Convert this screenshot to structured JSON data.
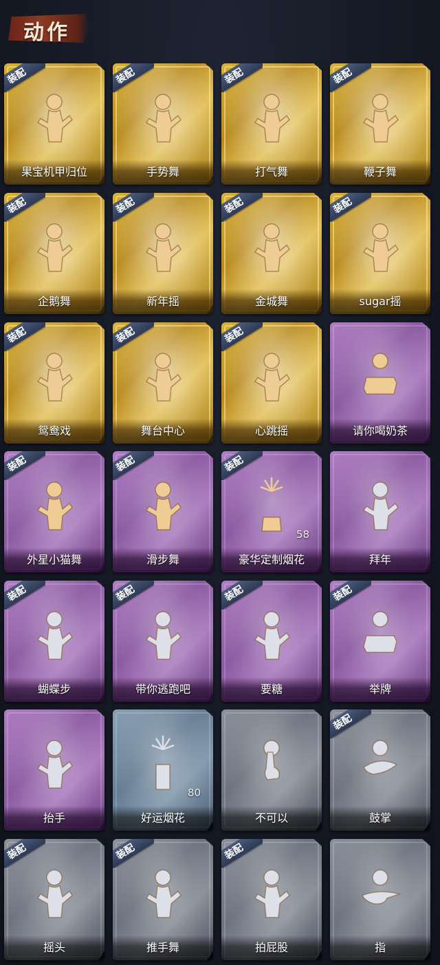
{
  "header": {
    "title": "动作"
  },
  "equip_label": "装配",
  "cards": [
    {
      "label": "果宝机甲归位",
      "tier": "gold",
      "equipped": true,
      "icon": "dance-figure-icon"
    },
    {
      "label": "手势舞",
      "tier": "gold",
      "equipped": true,
      "icon": "dance-figure-icon"
    },
    {
      "label": "打气舞",
      "tier": "gold",
      "equipped": true,
      "icon": "dance-figure-icon"
    },
    {
      "label": "鞭子舞",
      "tier": "gold",
      "equipped": true,
      "icon": "dance-figure-icon"
    },
    {
      "label": "企鹅舞",
      "tier": "gold",
      "equipped": true,
      "icon": "dance-figure-icon"
    },
    {
      "label": "新年摇",
      "tier": "gold",
      "equipped": true,
      "icon": "dance-figure-icon"
    },
    {
      "label": "金城舞",
      "tier": "gold",
      "equipped": true,
      "icon": "dance-figure-icon"
    },
    {
      "label": "sugar摇",
      "tier": "gold",
      "equipped": true,
      "icon": "dance-figure-icon"
    },
    {
      "label": "鸳鸯戏",
      "tier": "gold",
      "equipped": true,
      "icon": "dance-figure-icon"
    },
    {
      "label": "舞台中心",
      "tier": "gold",
      "equipped": true,
      "icon": "dance-figure-icon"
    },
    {
      "label": "心跳摇",
      "tier": "gold",
      "equipped": true,
      "icon": "dance-figure-icon"
    },
    {
      "label": "请你喝奶茶",
      "tier": "purple",
      "equipped": false,
      "icon": "sign-figure-icon"
    },
    {
      "label": "外星小猫舞",
      "tier": "purple",
      "equipped": true,
      "icon": "dance-figure-icon"
    },
    {
      "label": "滑步舞",
      "tier": "purple",
      "equipped": true,
      "icon": "dance-figure-icon"
    },
    {
      "label": "豪华定制烟花",
      "tier": "purple",
      "equipped": true,
      "icon": "fireworks-box-icon",
      "count": "58"
    },
    {
      "label": "拜年",
      "tier": "purple",
      "equipped": false,
      "icon": "bow-figure-icon"
    },
    {
      "label": "蝴蝶步",
      "tier": "purple",
      "equipped": true,
      "icon": "dance-figure-icon"
    },
    {
      "label": "带你逃跑吧",
      "tier": "purple",
      "equipped": true,
      "icon": "dance-figure-icon"
    },
    {
      "label": "要糖",
      "tier": "purple",
      "equipped": true,
      "icon": "reach-figure-icon"
    },
    {
      "label": "举牌",
      "tier": "purple",
      "equipped": true,
      "icon": "sign-figure-icon"
    },
    {
      "label": "抬手",
      "tier": "purple",
      "equipped": false,
      "icon": "raise-hand-figure-icon"
    },
    {
      "label": "好运烟花",
      "tier": "blue",
      "equipped": false,
      "icon": "firework-can-icon",
      "count": "80"
    },
    {
      "label": "不可以",
      "tier": "silver",
      "equipped": false,
      "icon": "finger-wag-icon"
    },
    {
      "label": "鼓掌",
      "tier": "silver",
      "equipped": true,
      "icon": "clap-hands-icon"
    },
    {
      "label": "摇头",
      "tier": "silver",
      "equipped": true,
      "icon": "shake-head-figure-icon"
    },
    {
      "label": "推手舞",
      "tier": "silver",
      "equipped": true,
      "icon": "push-hands-figure-icon"
    },
    {
      "label": "拍屁股",
      "tier": "silver",
      "equipped": true,
      "icon": "pat-figure-icon"
    },
    {
      "label": "指",
      "tier": "silver",
      "equipped": false,
      "icon": "point-hand-icon"
    }
  ],
  "colors": {
    "gold": "#d9b33a",
    "purple": "#9c6db2",
    "silver": "#7c818c",
    "blue": "#7790a6",
    "equip_badge": "#34415f",
    "figure_gold": "#f0cc95",
    "figure_silver": "#dde0e8"
  }
}
